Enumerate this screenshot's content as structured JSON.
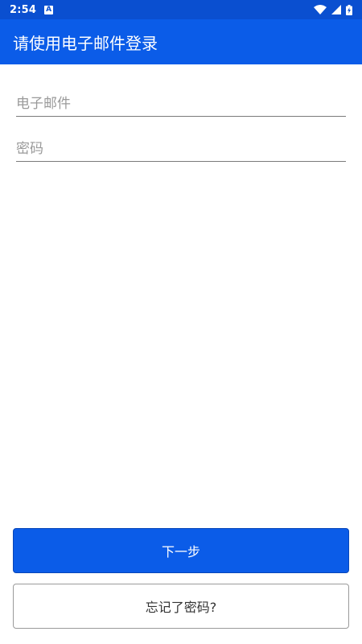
{
  "status_bar": {
    "time": "2:54",
    "notification_icon": "A",
    "icons": [
      "wifi-icon",
      "signal-icon",
      "battery-charging-icon"
    ]
  },
  "app_bar": {
    "title": "请使用电子邮件登录"
  },
  "form": {
    "email": {
      "value": "",
      "placeholder": "电子邮件"
    },
    "password": {
      "value": "",
      "placeholder": "密码"
    }
  },
  "buttons": {
    "next_label": "下一步",
    "forgot_label": "忘记了密码?"
  },
  "colors": {
    "primary": "#0b5ce8",
    "status_bar": "#0a4fd0",
    "background": "#ffffff"
  }
}
